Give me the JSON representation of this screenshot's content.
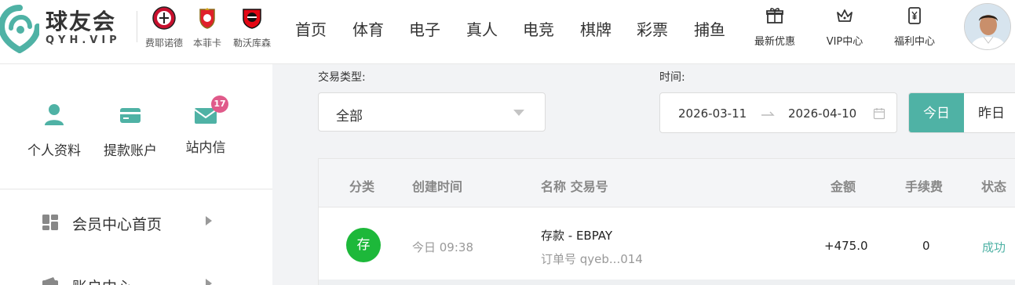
{
  "brand": {
    "name": "球友会",
    "domain": "QYH.VIP",
    "colors": {
      "accent": "#4fb2a5",
      "deposit_green": "#1db83a",
      "badge_pink": "#e05a8a"
    }
  },
  "clubs": [
    {
      "name": "费耶诺德",
      "icon": "feyenoord-crest-icon"
    },
    {
      "name": "本菲卡",
      "icon": "benfica-crest-icon"
    },
    {
      "name": "勒沃库森",
      "icon": "leverkusen-crest-icon"
    }
  ],
  "nav": [
    "首页",
    "体育",
    "电子",
    "真人",
    "电竞",
    "棋牌",
    "彩票",
    "捕鱼"
  ],
  "utilities": [
    {
      "label": "最新优惠",
      "icon": "gift-icon"
    },
    {
      "label": "VIP中心",
      "icon": "crown-icon"
    },
    {
      "label": "福利中心",
      "icon": "yen-card-icon"
    }
  ],
  "sidebar": {
    "quick": [
      {
        "label": "个人资料",
        "icon": "user-icon"
      },
      {
        "label": "提款账户",
        "icon": "card-icon"
      },
      {
        "label": "站内信",
        "icon": "mail-icon",
        "badge": "17"
      }
    ],
    "menu": [
      {
        "label": "会员中心首页",
        "icon": "dashboard-icon"
      },
      {
        "label": "账户中心",
        "icon": "wallet-icon"
      }
    ]
  },
  "filters": {
    "type_label": "交易类型:",
    "type_value": "全部",
    "time_label": "时间:",
    "date_start": "2026-03-11",
    "date_end": "2026-04-10",
    "quick_today": "今日",
    "quick_yesterday": "昨日"
  },
  "table": {
    "headers": {
      "category": "分类",
      "created": "创建时间",
      "name": "名称 交易号",
      "amount": "金额",
      "fee": "手续费",
      "status": "状态"
    },
    "rows": [
      {
        "badge": "存",
        "time": "今日 09:38",
        "name": "存款 - EBPAY",
        "order": "订单号 qyeb...014",
        "amount": "+475.0",
        "fee": "0",
        "status": "成功"
      }
    ]
  }
}
